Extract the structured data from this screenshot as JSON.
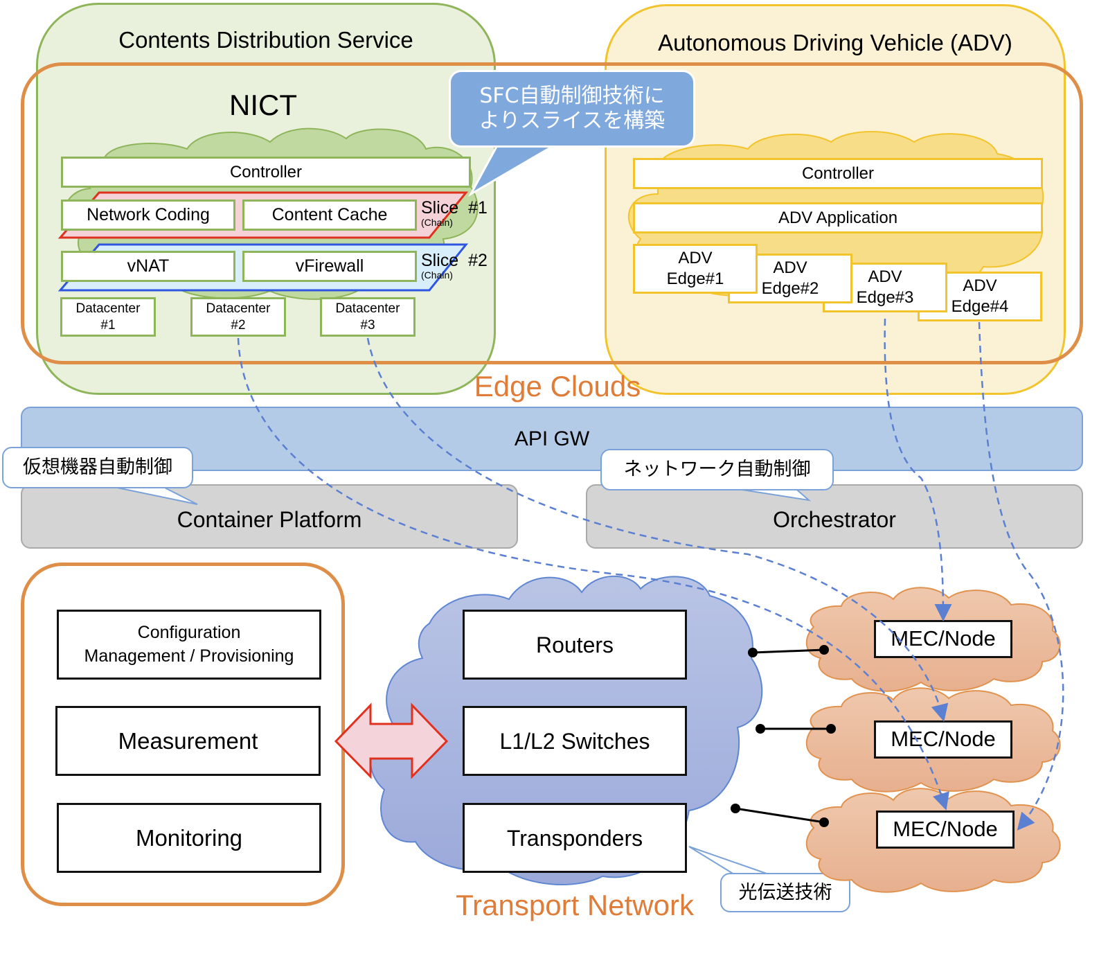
{
  "edge_clouds": {
    "label": "Edge Clouds",
    "contents_service": {
      "title": "Contents Distribution Service",
      "provider": "NICT",
      "controller": "Controller",
      "slices": [
        {
          "label": "Slice  #1",
          "sub": "(Chain)",
          "functions": [
            "Network Coding",
            "Content Cache"
          ],
          "color": "#e0301e"
        },
        {
          "label": "Slice  #2",
          "sub": "(Chain)",
          "functions": [
            "vNAT",
            "vFirewall"
          ],
          "color": "#2f56e0"
        }
      ],
      "datacenters": [
        {
          "line1": "Datacenter",
          "line2": "#1"
        },
        {
          "line1": "Datacenter",
          "line2": "#2"
        },
        {
          "line1": "Datacenter",
          "line2": "#3"
        }
      ]
    },
    "adv_service": {
      "title": "Autonomous Driving Vehicle (ADV)",
      "controller": "Controller",
      "application": "ADV Application",
      "edges": [
        {
          "line1": "ADV",
          "line2": "Edge#1"
        },
        {
          "line1": "ADV",
          "line2": "Edge#2"
        },
        {
          "line1": "ADV",
          "line2": "Edge#3"
        },
        {
          "line1": "ADV",
          "line2": "Edge#4"
        }
      ]
    },
    "sfc_callout": {
      "line1": "SFC自動制御技術に",
      "line2": "よりスライスを構築"
    }
  },
  "api_gw": {
    "label": "API GW"
  },
  "container_platform": {
    "label": "Container Platform",
    "callout": "仮想機器自動制御"
  },
  "orchestrator": {
    "label": "Orchestrator",
    "callout": "ネットワーク自動制御"
  },
  "management": {
    "items": [
      {
        "line1": "Configuration",
        "line2": "Management / Provisioning"
      },
      {
        "line1": "Measurement",
        "line2": ""
      },
      {
        "line1": "Monitoring",
        "line2": ""
      }
    ]
  },
  "transport_network": {
    "label": "Transport Network",
    "devices": [
      "Routers",
      "L1/L2 Switches",
      "Transponders"
    ],
    "optical_callout": "光伝送技術"
  },
  "mec_nodes": [
    "MEC/Node",
    "MEC/Node",
    "MEC/Node"
  ],
  "colors": {
    "edge_orange": "#df8e48",
    "green_panel": "#e9f1dd",
    "yellow_panel": "#fbf1d4",
    "api_blue": "#b4cbe8",
    "transport_cloud": "#a9b6df",
    "mec_cloud": "#eabb9c",
    "dashed_link": "#5b7fd1"
  }
}
